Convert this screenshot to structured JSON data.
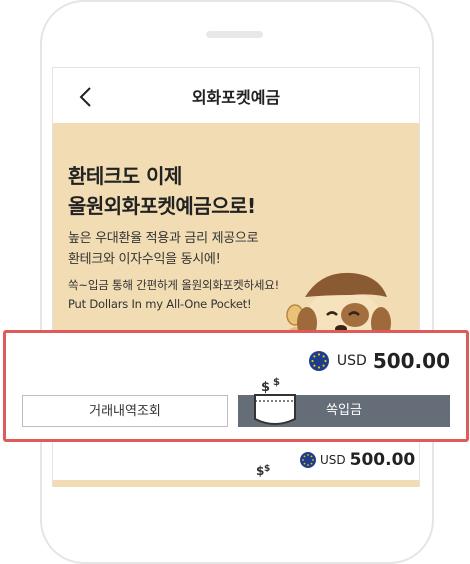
{
  "header": {
    "title": "외화포켓예금",
    "back_icon": "chevron-left-icon"
  },
  "banner": {
    "background": "#f1dcb3",
    "headline": [
      "환테크도 이제",
      "올원외화포켓예금으로!"
    ],
    "subtext": [
      "높은 우대환율 적용과 금리 제공으로",
      "환테크와 이자수익을 동시에!"
    ],
    "small_text": [
      "쏙~입금 통해 간편하게 올원외화포켓하세요!",
      "Put Dollars In my All-One Pocket!"
    ],
    "mascot_icon": "dog-mascot-icon"
  },
  "popup": {
    "border_color": "#e15a5a",
    "flag_icon": "eu-flag-icon",
    "currency": "USD",
    "amount": "500.00",
    "history_button": "거래내역조회",
    "deposit_button": "쏙입금",
    "deposit_color": "#656e78",
    "pocket_icon": "dollar-pocket-icon"
  },
  "bottom_preview": {
    "currency": "USD",
    "amount": "500.00"
  }
}
